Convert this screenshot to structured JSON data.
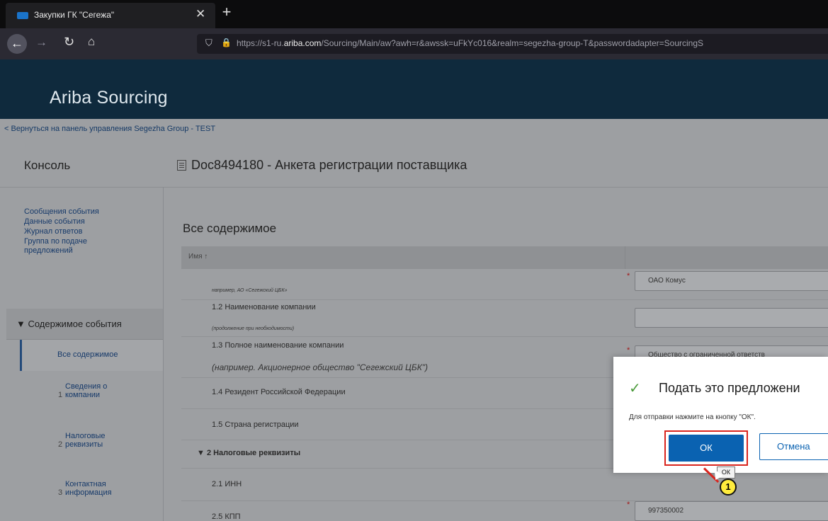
{
  "browser": {
    "tab_title": "Закупки ГК \"Сегежа\"",
    "tab_close": "✕",
    "new_tab": "+",
    "url_prefix": "https://s1-ru.",
    "url_domain": "ariba.com",
    "url_rest": "/Sourcing/Main/aw?awh=r&awssk=uFkYc016&realm=segezha-group-T&passwordadapter=SourcingS"
  },
  "header": {
    "logo": "Ariba Sourcing"
  },
  "breadcrumb": "< Вернуться на панель управления Segezha Group - TEST",
  "console_title": "Консоль",
  "doc_title": "Doc8494180 - Анкета регистрации поставщика",
  "sidebar": {
    "links": [
      "Сообщения события",
      "Данные события",
      "Журнал ответов",
      "Группа по подаче предложений"
    ],
    "section": "▼ Содержимое события",
    "active": "Все содержимое",
    "items": [
      {
        "num": "1",
        "label": "Сведения о компании"
      },
      {
        "num": "2",
        "label": "Налоговые реквизиты"
      },
      {
        "num": "3",
        "label": "Контактная информация"
      }
    ]
  },
  "main": {
    "title": "Все содержимое",
    "column_name": "Имя ↑",
    "rows": {
      "hint_1_1": "например, АО «Сегежский ЦБК»",
      "label_1_2": "1.2  Наименование компании",
      "hint_1_2": "(продолжение при необходимости)",
      "label_1_3": "1.3  Полное наименование компании",
      "hint_1_3": "(например. Акционерное общество \"Сегежский ЦБК\")",
      "label_1_4": "1.4  Резидент Российской Федерации",
      "label_1_5": "1.5  Страна регистрации",
      "label_2": "▼ 2  Налоговые реквизиты",
      "label_2_1": "2.1  ИНН",
      "label_2_5": "2.5  КПП"
    },
    "fields": {
      "company_name": "ОАО Комус",
      "company_name_cont": "",
      "full_name": "Общество с ограниченной ответств",
      "kpp": "997350002"
    },
    "required_mark": "*"
  },
  "dialog": {
    "check": "✓",
    "title": "Подать это предложени",
    "text": "Для отправки нажмите на кнопку \"ОК\".",
    "ok": "ОК",
    "cancel": "Отмена",
    "tooltip": "ОК",
    "callout": "1"
  }
}
